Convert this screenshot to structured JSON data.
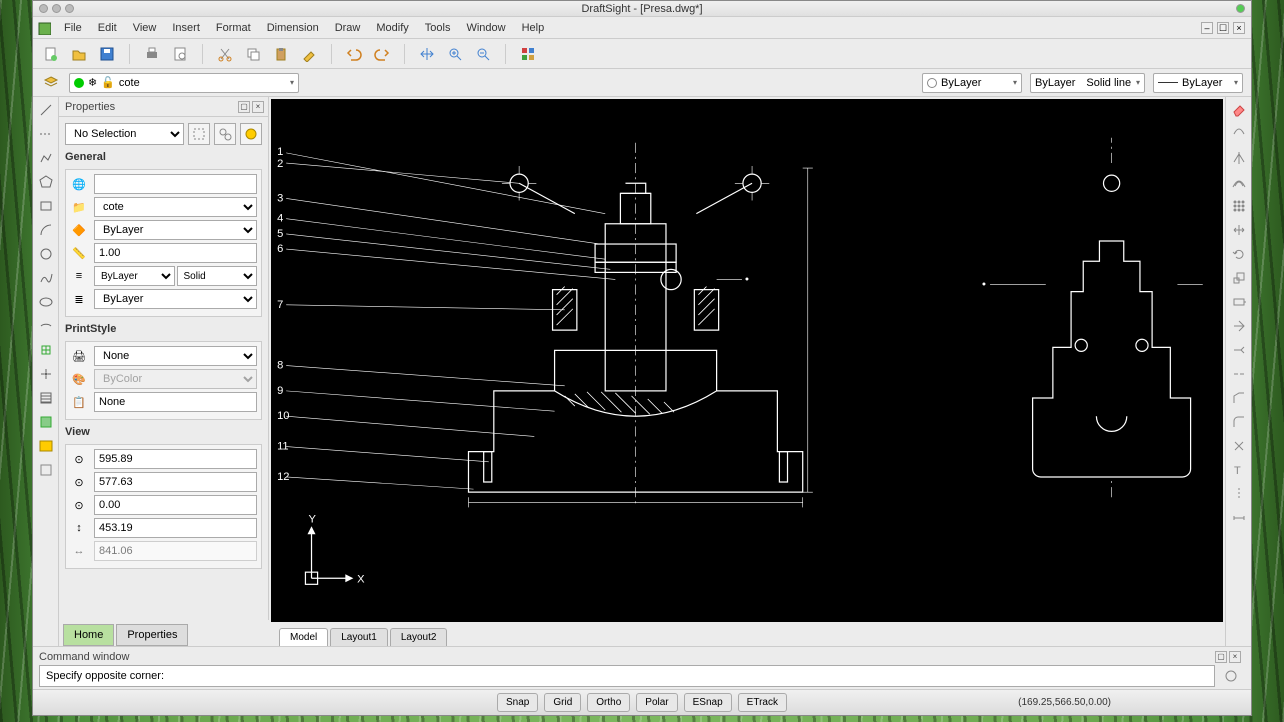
{
  "titlebar": {
    "title": "DraftSight - [Presa.dwg*]"
  },
  "menubar": {
    "items": [
      "File",
      "Edit",
      "View",
      "Insert",
      "Format",
      "Dimension",
      "Draw",
      "Modify",
      "Tools",
      "Window",
      "Help"
    ]
  },
  "layer_toolbar": {
    "layer_dropdown": "cote",
    "color_dropdown": "ByLayer",
    "linetype_a": "ByLayer",
    "linetype_b": "Solid line",
    "lineweight": "ByLayer"
  },
  "properties": {
    "title": "Properties",
    "selection": "No Selection",
    "groups": {
      "general_label": "General",
      "general": {
        "hyperlink": "",
        "layer": "cote",
        "linecolor": "ByLayer",
        "linescale": "1.00",
        "linestyle_a": "ByLayer",
        "linestyle_b": "Solid",
        "lineweight": "ByLayer"
      },
      "printstyle_label": "PrintStyle",
      "printstyle": {
        "style": "None",
        "color": "ByColor",
        "table": "None"
      },
      "view_label": "View",
      "view": {
        "x": "595.89",
        "y": "577.63",
        "z": "0.00",
        "h": "453.19",
        "w": "841.06"
      }
    }
  },
  "panetabs": {
    "home": "Home",
    "properties": "Properties"
  },
  "modeltabs": {
    "model": "Model",
    "layout1": "Layout1",
    "layout2": "Layout2"
  },
  "command": {
    "title": "Command window",
    "text": "Specify opposite corner:"
  },
  "statusbar": {
    "buttons": [
      "Snap",
      "Grid",
      "Ortho",
      "Polar",
      "ESnap",
      "ETrack"
    ],
    "coords": "(169.25,566.50,0.00)"
  },
  "canvas": {
    "axis_x": "X",
    "axis_y": "Y",
    "callouts": [
      "1",
      "2",
      "3",
      "4",
      "5",
      "6",
      "7",
      "8",
      "9",
      "10",
      "11",
      "12"
    ]
  }
}
